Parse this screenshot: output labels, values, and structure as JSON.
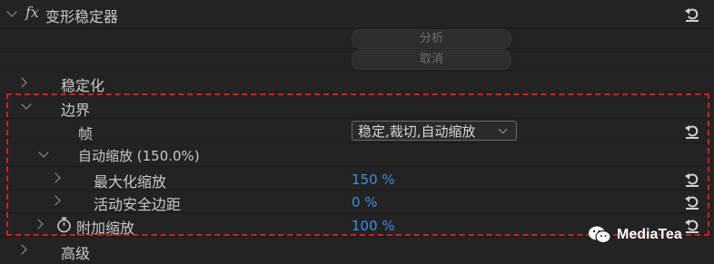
{
  "effect": {
    "fx_label": "fx",
    "title": "变形稳定器"
  },
  "buttons": {
    "analyze": "分析",
    "cancel": "取消"
  },
  "sections": {
    "stabilization": "稳定化",
    "borders": "边界",
    "frame_label": "帧",
    "frame_value": "稳定,裁切,自动缩放",
    "auto_scale": "自动缩放 (150.0%)",
    "max_scale_label": "最大化缩放",
    "max_scale_value": "150 %",
    "safe_margin_label": "活动安全边距",
    "safe_margin_value": "0 %",
    "additional_scale_label": "附加缩放",
    "additional_scale_value": "100 %",
    "advanced": "高级"
  },
  "watermark": {
    "text": "MediaTea"
  },
  "colors": {
    "value_blue": "#3d8ee6",
    "highlight_red": "#d61f1f",
    "background": "#232323"
  }
}
